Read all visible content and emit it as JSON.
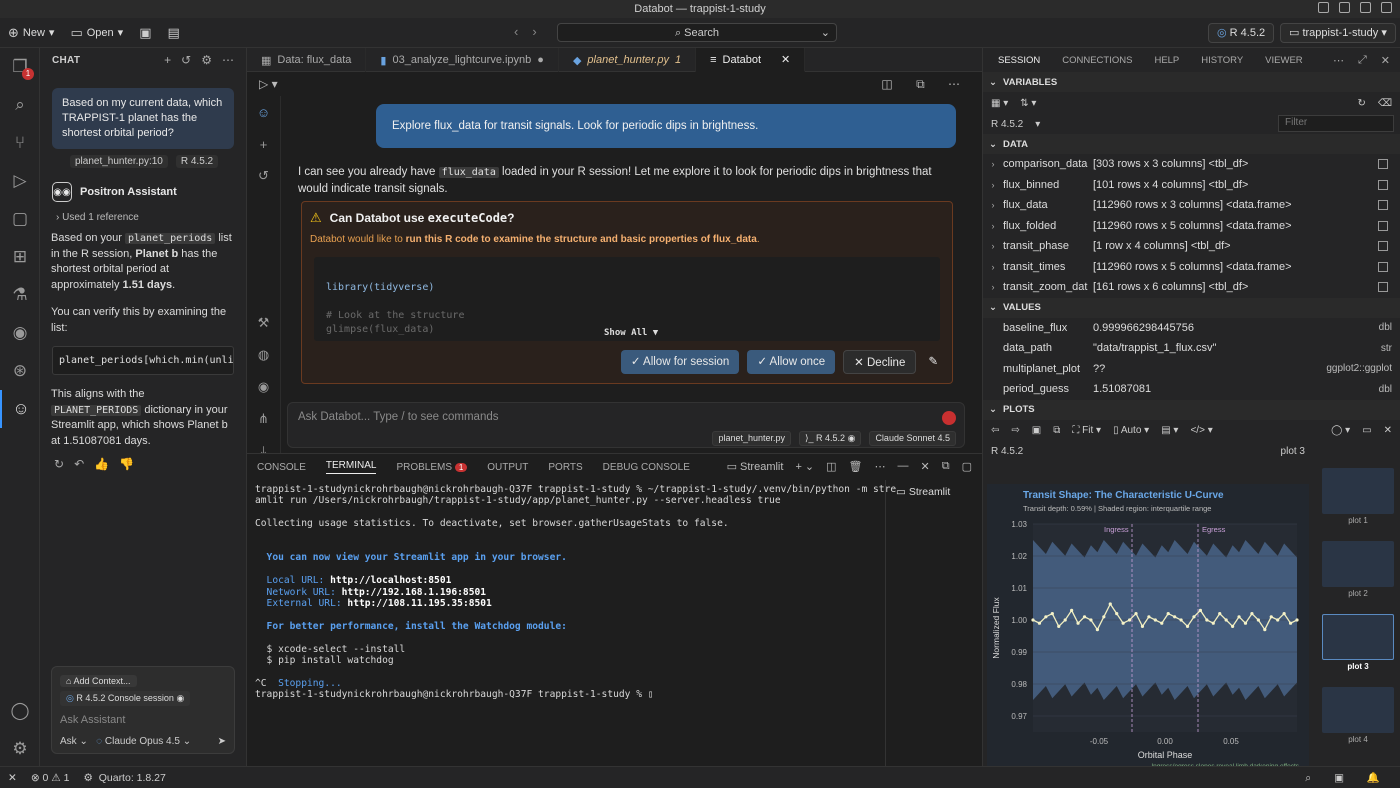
{
  "title": "Databot — trappist-1-study",
  "toolbar": {
    "new_label": "New",
    "open_label": "Open",
    "search_label": "Search",
    "r_version": "R 4.5.2",
    "project": "trappist-1-study"
  },
  "activity": {
    "badge": "1"
  },
  "chat": {
    "header": "CHAT",
    "user_msg": "Based on my current data, which TRAPPIST-1 planet has the shortest orbital period?",
    "ref_file": "planet_hunter.py:10",
    "ref_r": "R 4.5.2",
    "assistant_name": "Positron Assistant",
    "used_refs": "Used 1 reference",
    "p1_a": "Based on your ",
    "p1_code": "planet_periods",
    "p1_b": " list in the R session, ",
    "p1_bold": "Planet b",
    "p1_c": " has the shortest orbital period at approximately ",
    "p1_bold2": "1.51 days",
    "p1_d": ".",
    "p2": "You can verify this by examining the list:",
    "code": "planet_periods[which.min(unlis",
    "p3_a": "This aligns with the ",
    "p3_code": "PLANET_PERIODS",
    "p3_b": " dictionary in your Streamlit app, which shows Planet b at 1.51087081 days.",
    "add_context": "Add Context...",
    "console_session": "R 4.5.2 Console session",
    "placeholder": "Ask Assistant",
    "mode": "Ask",
    "model": "Claude Opus 4.5"
  },
  "editor": {
    "tabs": [
      {
        "label": "Data: flux_data"
      },
      {
        "label": "03_analyze_lightcurve.ipynb"
      },
      {
        "label": "planet_hunter.py",
        "badge": "1"
      },
      {
        "label": "Databot"
      }
    ],
    "prompt": "Explore flux_data for transit signals. Look for periodic dips in brightness.",
    "resp_a": "I can see you already have ",
    "resp_code": "flux_data",
    "resp_b": " loaded in your R session! Let me explore it to look for periodic dips in brightness that would indicate transit signals.",
    "perm_title_a": "Can Databot use ",
    "perm_title_code": "executeCode",
    "perm_title_b": "?",
    "perm_sub_a": "Databot would like to ",
    "perm_sub_b": "run this R code to examine the structure and basic properties of flux_data",
    "perm_sub_c": ".",
    "code_l1": "library(tidyverse)",
    "code_l2": "# Look at the structure",
    "code_l3": "glimpse(flux_data)",
    "show_all": "Show All ▼",
    "btn_session": "Allow for session",
    "btn_once": "Allow once",
    "btn_decline": "Decline",
    "ask_placeholder": "Ask Databot... Type / to see commands",
    "chip_file": "planet_hunter.py",
    "chip_r": "R 4.5.2",
    "chip_model": "Claude Sonnet 4.5"
  },
  "terminal": {
    "tabs": [
      "CONSOLE",
      "TERMINAL",
      "PROBLEMS",
      "OUTPUT",
      "PORTS",
      "DEBUG CONSOLE"
    ],
    "problems_badge": "1",
    "streamlit": "Streamlit",
    "l1": "trappist-1-studynickrohrbaugh@nickrohrbaugh-Q37F trappist-1-study % ~/trappist-1-study/.venv/bin/python -m stre",
    "l2": "amlit run /Users/nickrohrbaugh/trappist-1-study/app/planet_hunter.py --server.headless true",
    "l3": "Collecting usage statistics. To deactivate, set browser.gatherUsageStats to false.",
    "l4": "  You can now view your Streamlit app in your browser.",
    "l5a": "  Local URL: ",
    "l5b": "http://localhost:8501",
    "l6a": "  Network URL: ",
    "l6b": "http://192.168.1.196:8501",
    "l7a": "  External URL: ",
    "l7b": "http://108.11.195.35:8501",
    "l8": "  For better performance, install the Watchdog module:",
    "l9": "  $ xcode-select --install",
    "l10": "  $ pip install watchdog",
    "l11a": "^C  ",
    "l11b": "Stopping...",
    "l12": "trappist-1-studynickrohrbaugh@nickrohrbaugh-Q37F trappist-1-study % "
  },
  "session": {
    "tabs": [
      "SESSION",
      "CONNECTIONS",
      "HELP",
      "HISTORY",
      "VIEWER"
    ],
    "variables": "VARIABLES",
    "r_version": "R 4.5.2",
    "filter": "Filter",
    "data_header": "DATA",
    "data": [
      {
        "name": "comparison_data",
        "value": "[303 rows x 3 columns] <tbl_df>"
      },
      {
        "name": "flux_binned",
        "value": "[101 rows x 4 columns] <tbl_df>"
      },
      {
        "name": "flux_data",
        "value": "[112960 rows x 3 columns] <data.frame>"
      },
      {
        "name": "flux_folded",
        "value": "[112960 rows x 5 columns] <data.frame>"
      },
      {
        "name": "transit_phase",
        "value": "[1 row x 4 columns] <tbl_df>"
      },
      {
        "name": "transit_times",
        "value": "[112960 rows x 5 columns] <data.frame>"
      },
      {
        "name": "transit_zoom_dat",
        "value": "[161 rows x 6 columns] <tbl_df>"
      }
    ],
    "values_header": "VALUES",
    "values": [
      {
        "name": "baseline_flux",
        "value": "0.999966298445756",
        "type": "dbl"
      },
      {
        "name": "data_path",
        "value": "\"data/trappist_1_flux.csv\"",
        "type": "str"
      },
      {
        "name": "multiplanet_plot",
        "value": "??",
        "type": "ggplot2::ggplot"
      },
      {
        "name": "period_guess",
        "value": "1.51087081",
        "type": "dbl"
      },
      {
        "name": "planet_periods",
        "value": "[b = 1.51087081, c = 2.4218233, d = 4.04961, e = 6",
        "type": "list [7]"
      }
    ],
    "plots_header": "PLOTS",
    "fit": "Fit",
    "auto": "Auto",
    "plot_r": "R 4.5.2",
    "plot_num": "plot 3",
    "thumbs": [
      "plot 1",
      "plot 2",
      "plot 3",
      "plot 4"
    ]
  },
  "chart_data": {
    "type": "line",
    "title": "Transit Shape: The Characteristic U-Curve",
    "subtitle": "Transit depth: 0.59% | Shaded region: interquartile range",
    "xlabel": "Orbital Phase",
    "ylabel": "Normalized Flux",
    "xlim": [
      -0.1,
      0.1
    ],
    "ylim": [
      0.965,
      1.03
    ],
    "xticks": [
      "-0.05",
      "0.00",
      "0.05"
    ],
    "yticks": [
      "0.97",
      "0.98",
      "0.99",
      "1.00",
      "1.01",
      "1.02",
      "1.03"
    ],
    "annotations": [
      "Ingress",
      "Egress"
    ],
    "ingress": -0.025,
    "egress": 0.025,
    "caption": "Ingress/egress slopes reveal limb darkening effects",
    "median": [
      1.0,
      0.999,
      1.001,
      1.002,
      0.998,
      1.0,
      1.003,
      0.999,
      1.001,
      1.0,
      0.997,
      1.001,
      1.005,
      1.002,
      0.999,
      1.0,
      1.002,
      0.998,
      1.001,
      1.0,
      0.999,
      1.002,
      1.001,
      1.0,
      0.998,
      1.001,
      1.003,
      1.0,
      0.999,
      1.002,
      1.0,
      0.998,
      1.001,
      0.999,
      1.002,
      1.0,
      0.997,
      1.001,
      1.0,
      1.002,
      0.999,
      1.0
    ],
    "band_low": 0.975,
    "band_high": 1.025
  },
  "statusbar": {
    "errors": "0",
    "warnings": "1",
    "quarto": "Quarto: 1.8.27"
  }
}
